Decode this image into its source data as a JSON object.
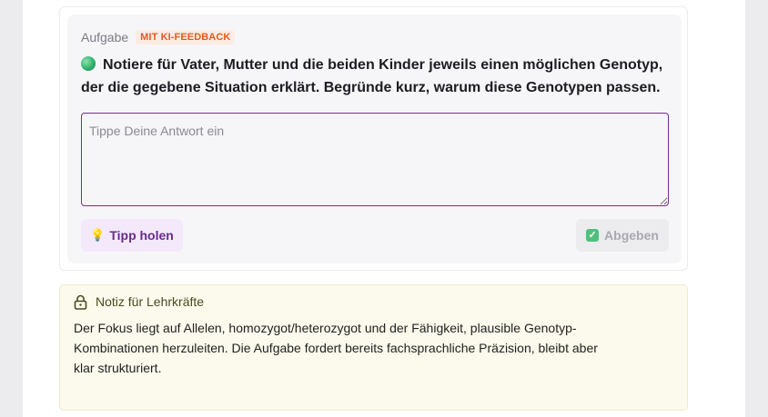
{
  "task": {
    "label": "Aufgabe",
    "badge": "MIT KI-FEEDBACK",
    "question": "Notiere für Vater, Mutter und die beiden Kinder jeweils einen möglichen Genotyp, der die gegebene Situation erklärt. Begründe kurz, warum diese Genotypen passen.",
    "answer_placeholder": "Tippe Deine Antwort ein",
    "answer_value": "",
    "tip_label": "Tipp holen",
    "submit_label": "Abgeben"
  },
  "note": {
    "title": "Notiz für Lehrkräfte",
    "body": "Der Fokus liegt auf Allelen, homozygot/heterozygot und der Fähigkeit, plausible Genotyp-Kombinationen herzuleiten. Die Aufgabe fordert bereits fachsprachliche Präzision, bleibt aber klar strukturiert."
  },
  "icons": {
    "question": "green-dot-icon",
    "tip": "lightbulb-icon",
    "submit": "checkmark-icon",
    "note": "lock-icon"
  },
  "colors": {
    "accent": "#7a2a9c",
    "badge": "#e8591f",
    "tip_text": "#6a2a8e",
    "note_bg": "#fcfaec"
  }
}
